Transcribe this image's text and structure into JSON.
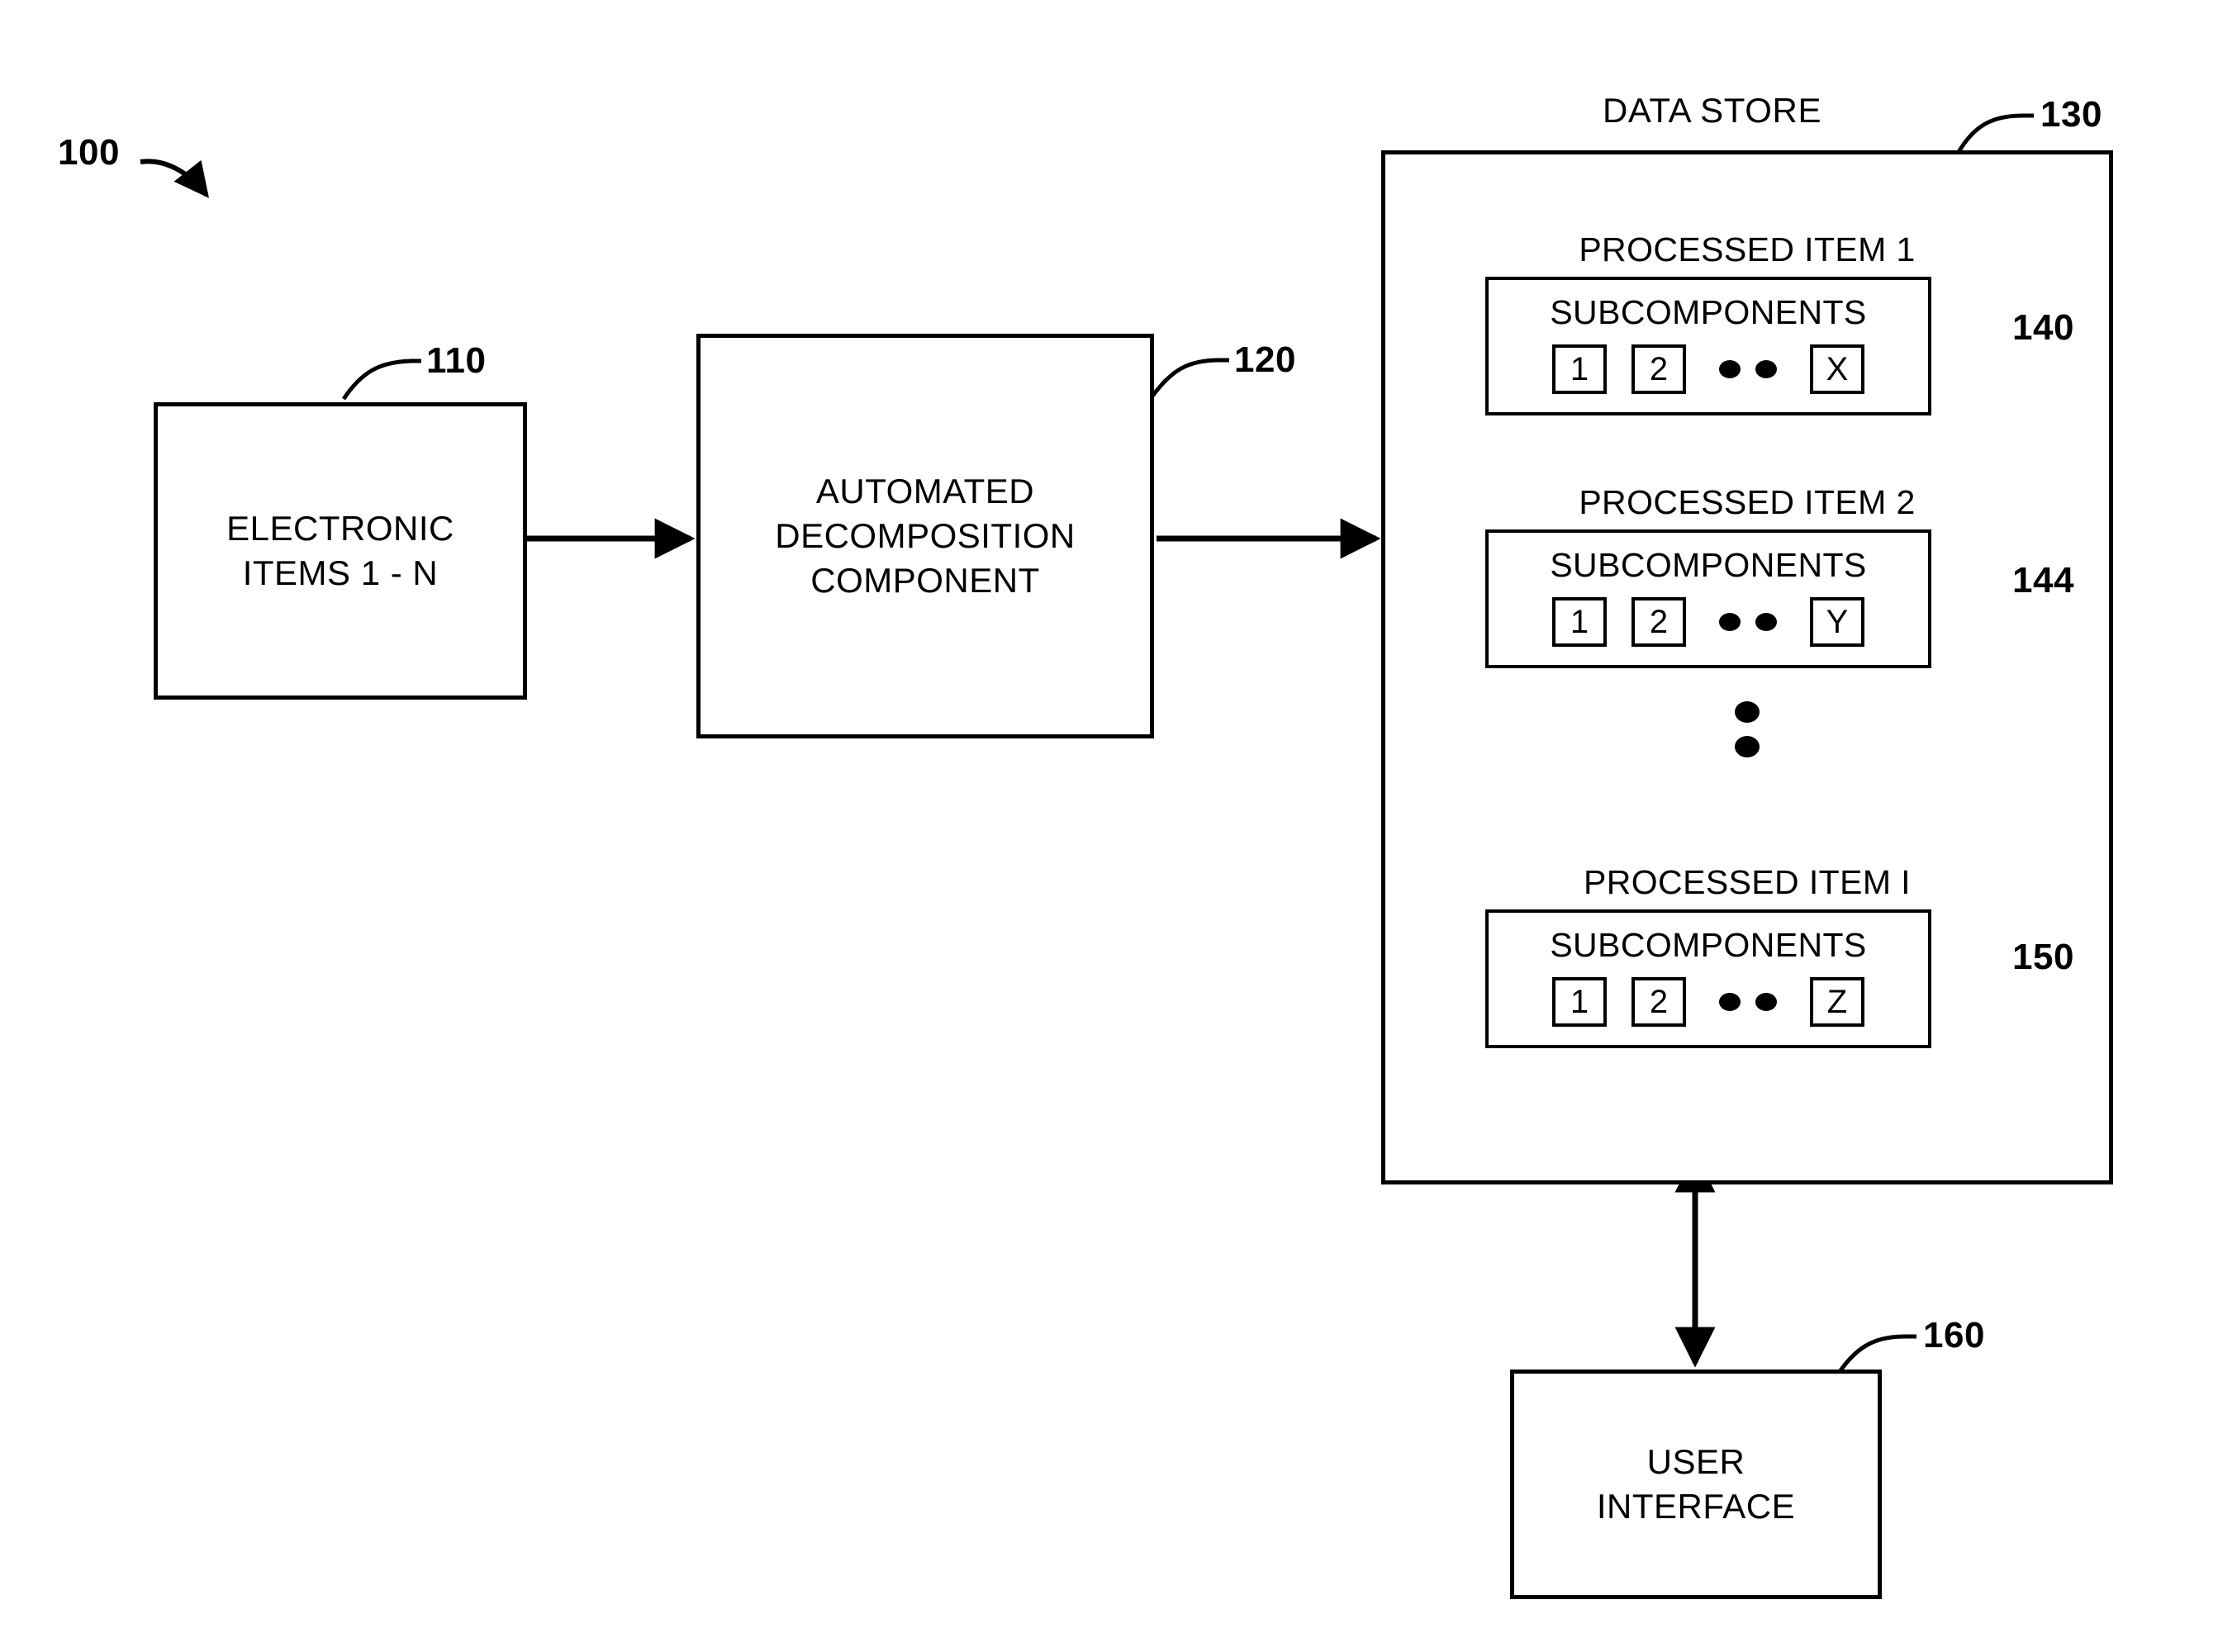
{
  "figure": {
    "reference_numeral": "100",
    "title_label": "DATA STORE"
  },
  "blocks": {
    "electronic_items": {
      "label": "ELECTRONIC\nITEMS 1 - N",
      "ref": "110"
    },
    "decomposition_component": {
      "label": "AUTOMATED\nDECOMPOSITION\nCOMPONENT",
      "ref": "120"
    },
    "data_store": {
      "label": "DATA STORE",
      "ref": "130"
    },
    "user_interface": {
      "label": "USER\nINTERFACE",
      "ref": "160"
    }
  },
  "processed_items": [
    {
      "title": "PROCESSED ITEM 1",
      "subcomponents_heading": "SUBCOMPONENTS",
      "chips": [
        "1",
        "2",
        "X"
      ],
      "ellipsis": "dot-dot",
      "ref": "140"
    },
    {
      "title": "PROCESSED ITEM 2",
      "subcomponents_heading": "SUBCOMPONENTS",
      "chips": [
        "1",
        "2",
        "Y"
      ],
      "ellipsis": "dot-dot",
      "ref": "144"
    },
    {
      "title": "PROCESSED ITEM I",
      "subcomponents_heading": "SUBCOMPONENTS",
      "chips": [
        "1",
        "2",
        "Z"
      ],
      "ellipsis": "dot-dot",
      "ref": "150"
    }
  ],
  "colors": {
    "ink": "#000000",
    "paper": "#ffffff"
  }
}
